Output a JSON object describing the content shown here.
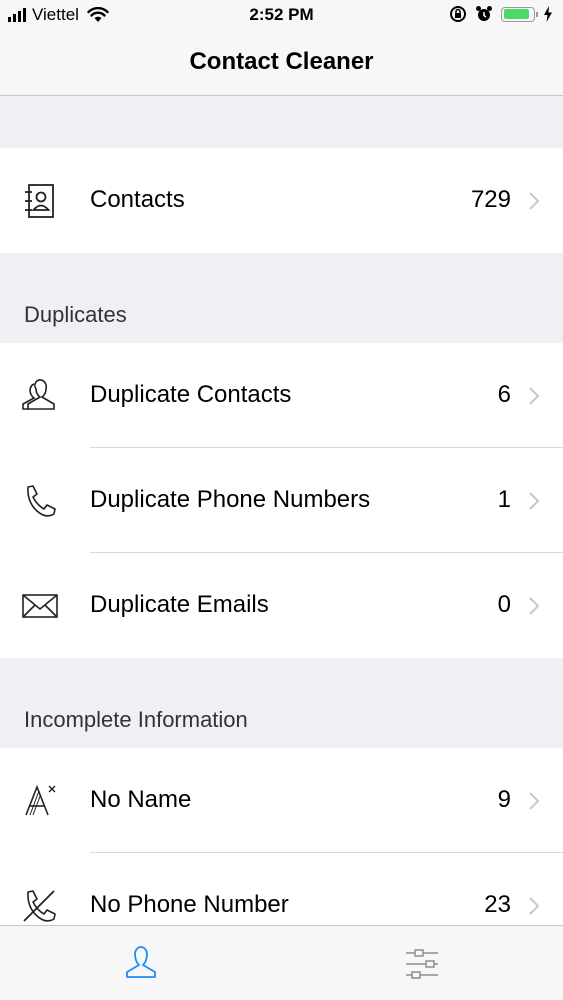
{
  "status_bar": {
    "carrier": "Viettel",
    "time": "2:52 PM",
    "signal_icon": "signal-bars-icon",
    "wifi_icon": "wifi-icon",
    "battery_level": 0.9
  },
  "nav": {
    "title": "Contact Cleaner"
  },
  "contacts_row": {
    "label": "Contacts",
    "count": "729",
    "icon": "address-book-icon"
  },
  "duplicates": {
    "header": "Duplicates",
    "items": [
      {
        "label": "Duplicate Contacts",
        "count": "6",
        "icon": "people-icon"
      },
      {
        "label": "Duplicate Phone Numbers",
        "count": "1",
        "icon": "phone-icon"
      },
      {
        "label": "Duplicate Emails",
        "count": "0",
        "icon": "envelope-icon"
      }
    ]
  },
  "incomplete": {
    "header": "Incomplete Information",
    "items": [
      {
        "label": "No Name",
        "count": "9",
        "icon": "no-name-icon"
      },
      {
        "label": "No Phone Number",
        "count": "23",
        "icon": "no-phone-icon"
      }
    ]
  },
  "tabbar": {
    "tabs": [
      {
        "icon": "person-icon",
        "active": true
      },
      {
        "icon": "sliders-icon",
        "active": false
      }
    ]
  },
  "colors": {
    "accent": "#1a8cff",
    "battery": "#4cd964",
    "background": "#efeff4"
  }
}
